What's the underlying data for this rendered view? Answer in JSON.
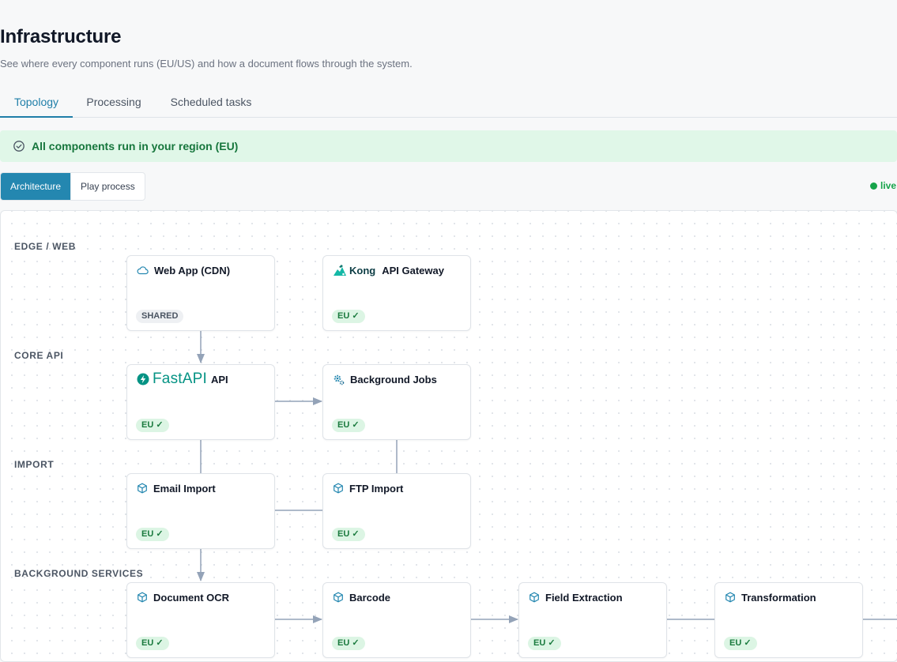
{
  "header": {
    "title": "Infrastructure",
    "subtitle": "See where every component runs (EU/US) and how a document flows through the system."
  },
  "tabs": [
    {
      "label": "Topology",
      "active": true
    },
    {
      "label": "Processing",
      "active": false
    },
    {
      "label": "Scheduled tasks",
      "active": false
    }
  ],
  "banner": {
    "text": "All components run in your region (EU)",
    "icon": "check-circle-icon",
    "color": "#16763c",
    "background": "#e0f7e8"
  },
  "view_toggle": {
    "architecture_label": "Architecture",
    "play_label": "Play process",
    "selected": "Architecture"
  },
  "status": {
    "live_label": "live",
    "color": "#16a34a"
  },
  "accent_color": "#2487b0",
  "lanes": {
    "edge": "EDGE / WEB",
    "core": "CORE API",
    "import": "IMPORT",
    "background": "BACKGROUND SERVICES"
  },
  "nodes": {
    "web_app": {
      "title": "Web App (CDN)",
      "badge": "SHARED",
      "icon": "cloud-icon"
    },
    "api_gateway": {
      "logo_text": "Kong",
      "title": "API Gateway",
      "badge": "EU ✓",
      "icon": "kong-logo-icon"
    },
    "api": {
      "logo_text": "FastAPI",
      "title": "API",
      "badge": "EU ✓",
      "icon": "fastapi-logo-icon"
    },
    "background_jobs": {
      "title": "Background Jobs",
      "badge": "EU ✓",
      "icon": "gear-icon"
    },
    "email_import": {
      "title": "Email Import",
      "badge": "EU ✓",
      "icon": "cube-icon"
    },
    "ftp_import": {
      "title": "FTP Import",
      "badge": "EU ✓",
      "icon": "cube-icon"
    },
    "document_ocr": {
      "title": "Document OCR",
      "badge": "EU ✓",
      "icon": "cube-icon"
    },
    "barcode": {
      "title": "Barcode",
      "badge": "EU ✓",
      "icon": "cube-icon"
    },
    "field_extraction": {
      "title": "Field Extraction",
      "badge": "EU ✓",
      "icon": "cube-icon"
    },
    "transformation": {
      "title": "Transformation",
      "badge": "EU ✓",
      "icon": "cube-icon"
    }
  }
}
